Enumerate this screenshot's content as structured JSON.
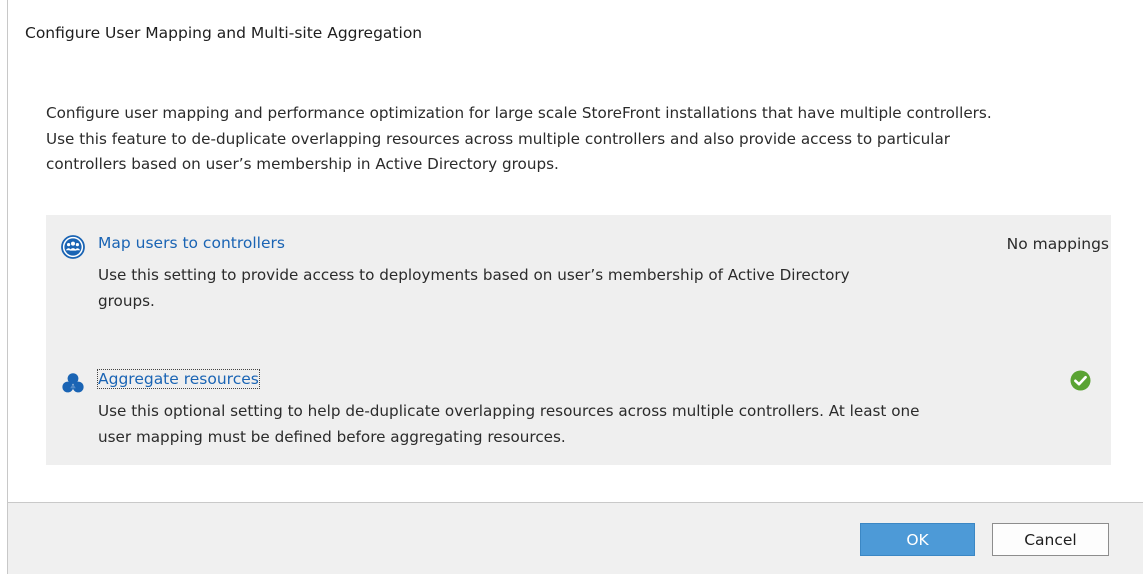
{
  "dialog": {
    "title": "Configure User Mapping and Multi-site Aggregation",
    "description_lines": [
      "Configure user mapping and performance optimization for large scale StoreFront installations that have multiple controllers.",
      "Use this feature to de-duplicate overlapping resources across multiple controllers and also provide access to particular",
      "controllers based on user’s membership in Active Directory groups."
    ]
  },
  "options": {
    "map_users": {
      "icon": "user-group-icon",
      "link_label": "Map users to controllers",
      "description_lines": [
        "Use this setting to provide access to deployments based on user’s membership of Active Directory",
        "groups."
      ],
      "status": "No mappings"
    },
    "aggregate": {
      "icon": "aggregate-resources-icon",
      "link_label": "Aggregate resources",
      "description_lines": [
        "Use this optional setting to help de-duplicate overlapping resources across multiple controllers. At least one",
        "user mapping must be defined before aggregating resources."
      ],
      "status_icon": "check-icon"
    }
  },
  "buttons": {
    "ok_label": "OK",
    "cancel_label": "Cancel"
  },
  "colors": {
    "link": "#1a64b4",
    "primary_button": "#4d9ad7",
    "check": "#5aa333",
    "panel_background": "#efefef"
  }
}
